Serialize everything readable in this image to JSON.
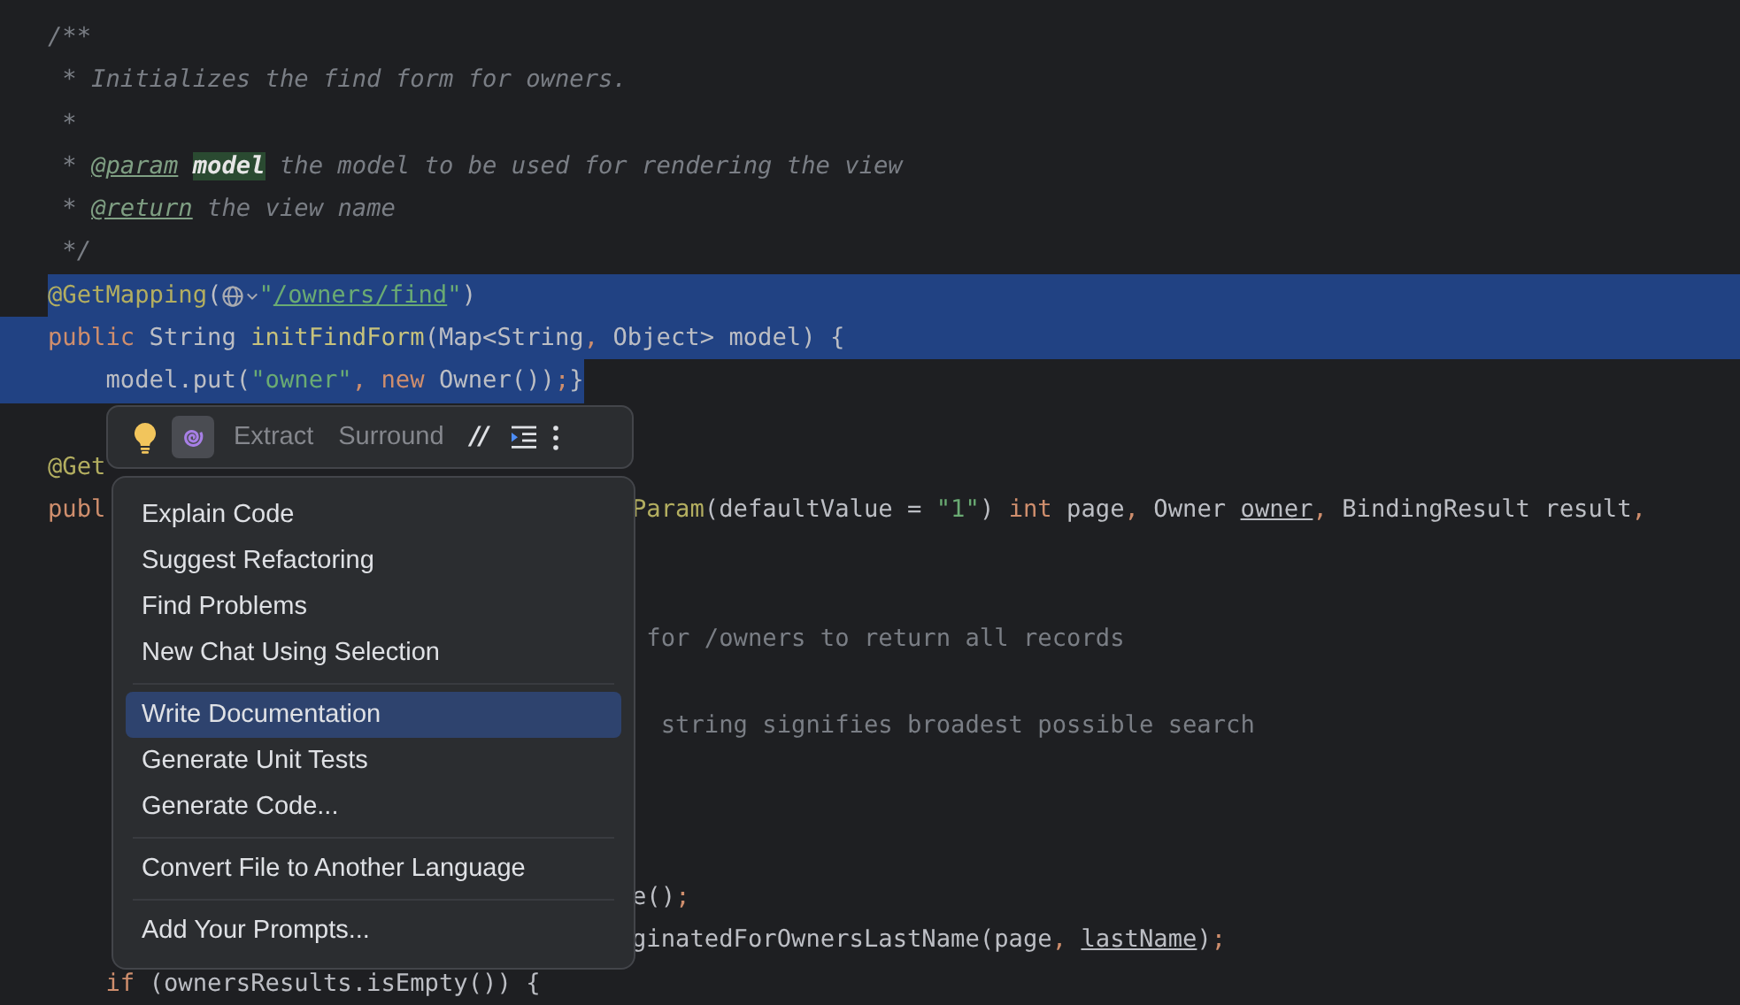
{
  "editor": {
    "lines": [
      {
        "selected": false,
        "tokens": [
          {
            "kind": "doc",
            "text": "/**"
          }
        ]
      },
      {
        "selected": false,
        "tokens": [
          {
            "kind": "doc",
            "text": " * Initializes the find form for owners."
          }
        ]
      },
      {
        "selected": false,
        "tokens": [
          {
            "kind": "doc",
            "text": " *"
          }
        ]
      },
      {
        "selected": false,
        "tokens": [
          {
            "kind": "doc",
            "text": " * "
          },
          {
            "kind": "doctag",
            "text": "@param"
          },
          {
            "kind": "param",
            "text": "model"
          },
          {
            "kind": "doc",
            "text": " the model to be used for rendering the view"
          }
        ]
      },
      {
        "selected": false,
        "tokens": [
          {
            "kind": "doc",
            "text": " * "
          },
          {
            "kind": "doctag",
            "text": "@return"
          },
          {
            "kind": "doc",
            "text": " the view name"
          }
        ]
      },
      {
        "selected": false,
        "tokens": [
          {
            "kind": "doc",
            "text": " */"
          }
        ]
      },
      {
        "selected": true,
        "tokens": [
          {
            "kind": "annotation",
            "text": "@GetMapping"
          },
          {
            "kind": "plain",
            "text": "("
          },
          {
            "kind": "globe"
          },
          {
            "kind": "string",
            "text": "\""
          },
          {
            "kind": "link",
            "text": "/owners/find"
          },
          {
            "kind": "string",
            "text": "\""
          },
          {
            "kind": "plain",
            "text": ")"
          }
        ]
      },
      {
        "selected": true,
        "tokens": [
          {
            "kind": "keyword",
            "text": "public"
          },
          {
            "kind": "plain",
            "text": " String "
          },
          {
            "kind": "method",
            "text": "initFindForm"
          },
          {
            "kind": "plain",
            "text": "(Map<String"
          },
          {
            "kind": "keyword",
            "text": ","
          },
          {
            "kind": "plain",
            "text": " Object> model) {"
          }
        ]
      },
      {
        "selected": true,
        "tokens": [
          {
            "kind": "plain",
            "text": "    model.put("
          },
          {
            "kind": "string",
            "text": "\"owner\""
          },
          {
            "kind": "keyword",
            "text": ", new "
          },
          {
            "kind": "plain",
            "text": "Owner())"
          },
          {
            "kind": "keyword",
            "text": ";"
          },
          {
            "kind": "plain",
            "text": "}"
          }
        ]
      },
      {
        "selected": false
      },
      {
        "selected": false,
        "tokens": [
          {
            "kind": "annotation",
            "text": "@Get"
          }
        ]
      },
      {
        "selected": false,
        "tokens": [
          {
            "kind": "keyword",
            "text": "publ"
          }
        ],
        "after": [
          {
            "kind": "annotation",
            "text": "Param"
          },
          {
            "kind": "plain",
            "text": "(defaultValue = "
          },
          {
            "kind": "string",
            "text": "\"1\""
          },
          {
            "kind": "plain",
            "text": ") "
          },
          {
            "kind": "keyword",
            "text": "int"
          },
          {
            "kind": "plain",
            "text": " page"
          },
          {
            "kind": "keyword",
            "text": ","
          },
          {
            "kind": "plain",
            "text": " Owner "
          },
          {
            "kind": "underline",
            "text": "owner"
          },
          {
            "kind": "keyword",
            "text": ","
          },
          {
            "kind": "plain",
            "text": " BindingResult result"
          },
          {
            "kind": "keyword",
            "text": ","
          }
        ]
      },
      {
        "selected": false
      },
      {
        "selected": false
      },
      {
        "selected": false,
        "after": [
          {
            "kind": "comment",
            "text": " for /owners to return all records"
          }
        ]
      },
      {
        "selected": false
      },
      {
        "selected": false,
        "after": [
          {
            "kind": "comment",
            "text": "  string signifies broadest possible search"
          }
        ]
      },
      {
        "selected": false
      },
      {
        "selected": false
      },
      {
        "selected": false
      },
      {
        "selected": false,
        "after": [
          {
            "kind": "plain",
            "text": "e()"
          },
          {
            "kind": "keyword",
            "text": ";"
          }
        ]
      },
      {
        "selected": false,
        "after": [
          {
            "kind": "plain",
            "text": "ginatedForOwnersLastName(page"
          },
          {
            "kind": "keyword",
            "text": ", "
          },
          {
            "kind": "underline",
            "text": "lastName"
          },
          {
            "kind": "plain",
            "text": ")"
          },
          {
            "kind": "keyword",
            "text": ";"
          }
        ]
      },
      {
        "selected": false,
        "tokens": [
          {
            "kind": "keyword",
            "text": "    if"
          },
          {
            "kind": "plain",
            "text": " (ownersResults.isEmpty()) {"
          }
        ]
      }
    ]
  },
  "toolbar": {
    "ai_selected": true,
    "actions": [
      {
        "label": "Extract"
      },
      {
        "label": "Surround"
      }
    ],
    "comment_glyph": "//"
  },
  "menu": {
    "groups": [
      [
        {
          "label": "Explain Code",
          "selected": false
        },
        {
          "label": "Suggest Refactoring",
          "selected": false
        },
        {
          "label": "Find Problems",
          "selected": false
        },
        {
          "label": "New Chat Using Selection",
          "selected": false
        }
      ],
      [
        {
          "label": "Write Documentation",
          "selected": true
        },
        {
          "label": "Generate Unit Tests",
          "selected": false
        },
        {
          "label": "Generate Code...",
          "selected": false
        }
      ],
      [
        {
          "label": "Convert File to Another Language",
          "selected": false
        }
      ],
      [
        {
          "label": "Add Your Prompts...",
          "selected": false
        }
      ]
    ]
  }
}
